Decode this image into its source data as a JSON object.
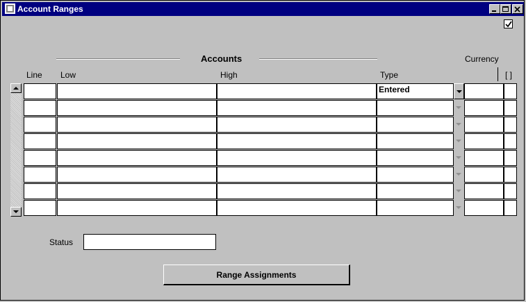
{
  "window": {
    "title": "Account Ranges"
  },
  "header": {
    "group_title": "Accounts",
    "currency_title": "Currency",
    "columns": {
      "line": "Line",
      "low": "Low",
      "high": "High",
      "type": "Type",
      "flex": "[ ]"
    }
  },
  "rows": [
    {
      "line": "",
      "low": "",
      "high": "",
      "type": "Entered",
      "currency": "",
      "flex": ""
    },
    {
      "line": "",
      "low": "",
      "high": "",
      "type": "",
      "currency": "",
      "flex": ""
    },
    {
      "line": "",
      "low": "",
      "high": "",
      "type": "",
      "currency": "",
      "flex": ""
    },
    {
      "line": "",
      "low": "",
      "high": "",
      "type": "",
      "currency": "",
      "flex": ""
    },
    {
      "line": "",
      "low": "",
      "high": "",
      "type": "",
      "currency": "",
      "flex": ""
    },
    {
      "line": "",
      "low": "",
      "high": "",
      "type": "",
      "currency": "",
      "flex": ""
    },
    {
      "line": "",
      "low": "",
      "high": "",
      "type": "",
      "currency": "",
      "flex": ""
    },
    {
      "line": "",
      "low": "",
      "high": "",
      "type": "",
      "currency": "",
      "flex": ""
    }
  ],
  "status": {
    "label": "Status",
    "value": ""
  },
  "actions": {
    "range_assignments": "Range Assignments"
  },
  "top_checkbox": {
    "checked": true
  },
  "colors": {
    "titlebar": "#000080",
    "window_bg": "#c0c0c0"
  }
}
